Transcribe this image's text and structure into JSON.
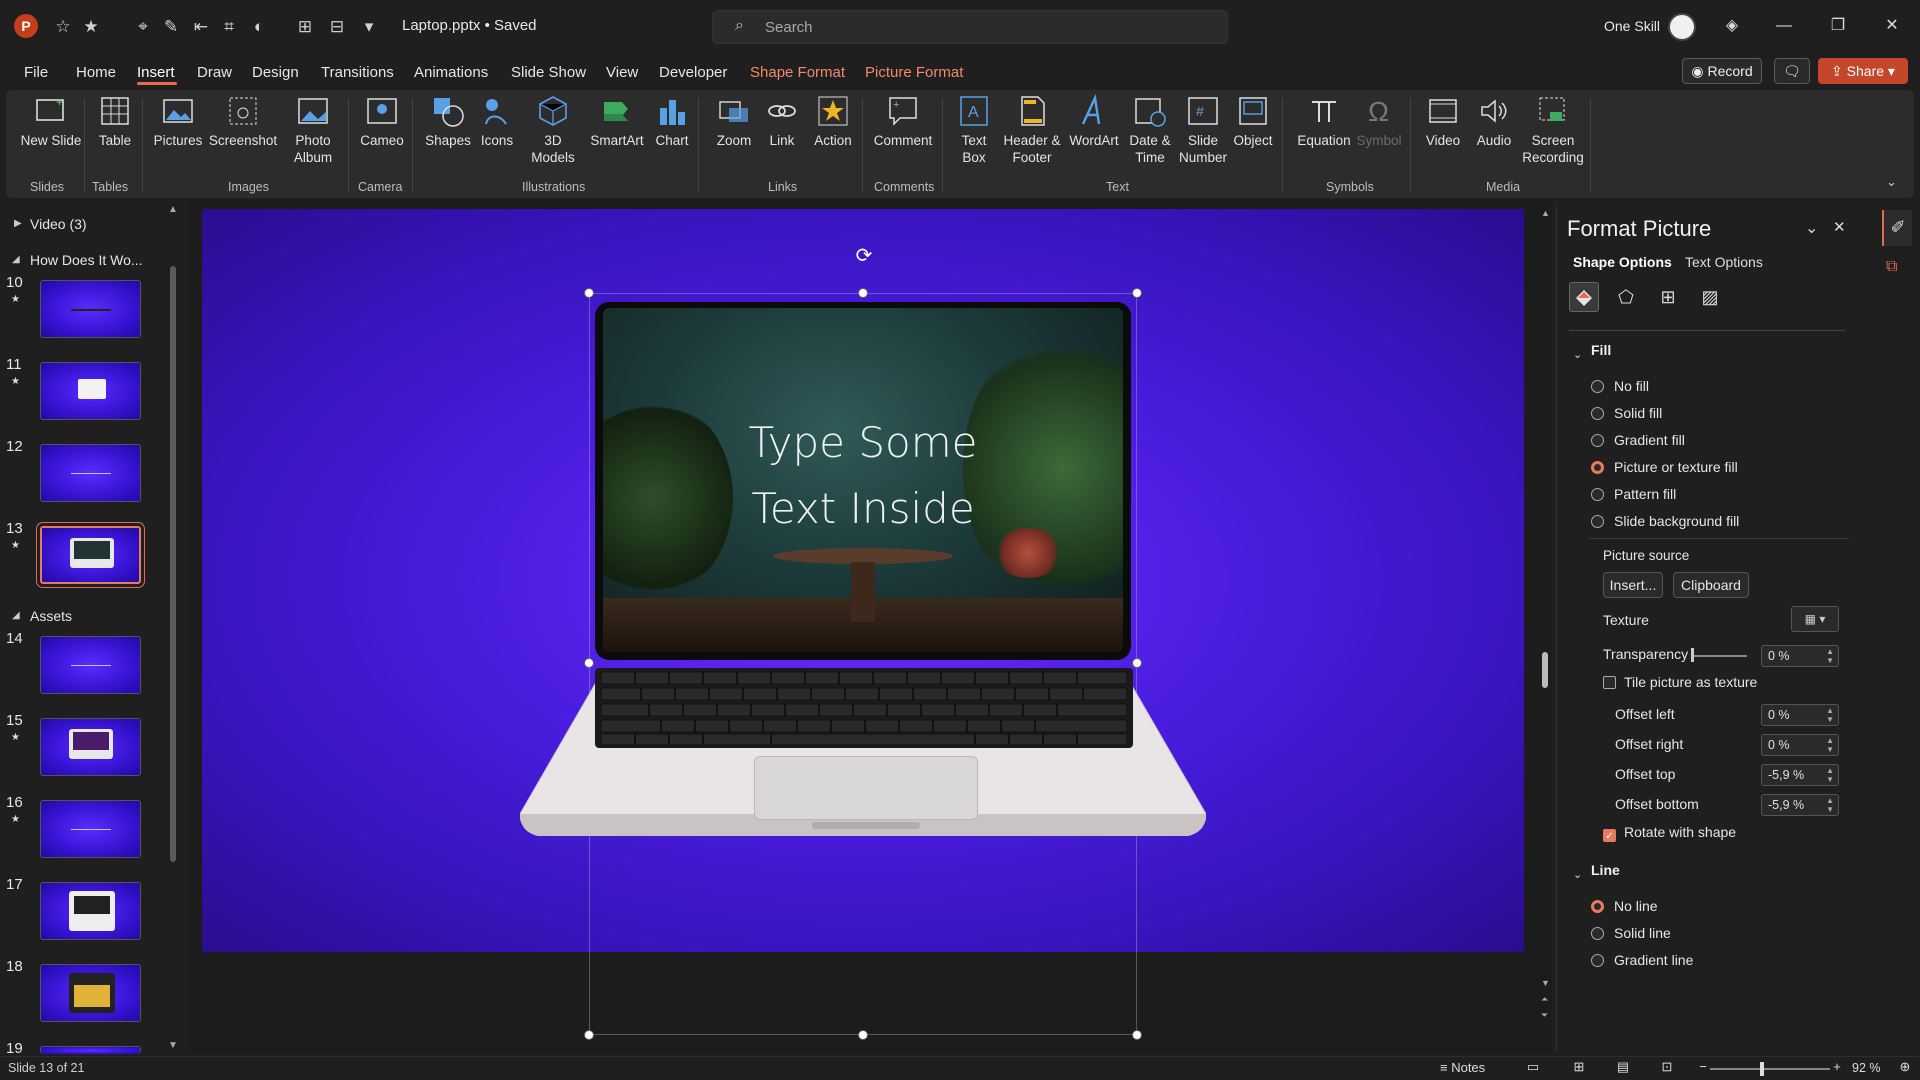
{
  "titlebar": {
    "doc_title": "Laptop.pptx • Saved",
    "search_placeholder": "Search",
    "user_name": "One Skill",
    "minimize": "—",
    "restore": "❐",
    "close": "✕"
  },
  "menu": {
    "tabs": [
      "File",
      "Home",
      "Insert",
      "Draw",
      "Design",
      "Transitions",
      "Animations",
      "Slide Show",
      "View",
      "Developer",
      "Shape Format",
      "Picture Format"
    ],
    "active": "Insert",
    "record": "Record",
    "share": "Share"
  },
  "ribbon": {
    "new_slide": "New Slide",
    "table": "Table",
    "pictures": "Pictures",
    "screenshot": "Screenshot",
    "photo_album": "Photo Album",
    "cameo": "Cameo",
    "shapes": "Shapes",
    "icons": "Icons",
    "models_3d": "3D Models",
    "smartart": "SmartArt",
    "chart": "Chart",
    "zoom": "Zoom",
    "link": "Link",
    "action": "Action",
    "comment": "Comment",
    "text_box": "Text Box",
    "header_footer": "Header & Footer",
    "wordart": "WordArt",
    "date_time": "Date & Time",
    "slide_number": "Slide Number",
    "object": "Object",
    "equation": "Equation",
    "symbol": "Symbol",
    "video": "Video",
    "audio": "Audio",
    "screen_recording": "Screen Recording",
    "groups": {
      "slides": "Slides",
      "tables": "Tables",
      "images": "Images",
      "camera": "Camera",
      "illustrations": "Illustrations",
      "links": "Links",
      "comments": "Comments",
      "text": "Text",
      "symbols": "Symbols",
      "media": "Media"
    }
  },
  "thumbnails": {
    "sections": [
      "Video (3)",
      "How Does It Wo...",
      "Assets"
    ],
    "numbers": [
      "10",
      "11",
      "12",
      "13",
      "14",
      "15",
      "16",
      "17",
      "18",
      "19"
    ],
    "selected": "13"
  },
  "slide": {
    "screen_line1": "Type Some",
    "screen_line2": "Text Inside"
  },
  "format_pane": {
    "title": "Format Picture",
    "tab_shape": "Shape Options",
    "tab_text": "Text Options",
    "fill_title": "Fill",
    "fill_options": [
      "No fill",
      "Solid fill",
      "Gradient fill",
      "Picture or texture fill",
      "Pattern fill",
      "Slide background fill"
    ],
    "fill_selected": "Picture or texture fill",
    "picture_source": "Picture source",
    "insert_btn": "Insert...",
    "clipboard_btn": "Clipboard",
    "texture": "Texture",
    "transparency": "Transparency",
    "transparency_val": "0 %",
    "tile_label": "Tile picture as texture",
    "offset_left": "Offset left",
    "offset_left_val": "0 %",
    "offset_right": "Offset right",
    "offset_right_val": "0 %",
    "offset_top": "Offset top",
    "offset_top_val": "-5,9 %",
    "offset_bottom": "Offset bottom",
    "offset_bottom_val": "-5,9 %",
    "rotate_label": "Rotate with shape",
    "line_title": "Line",
    "line_options": [
      "No line",
      "Solid line",
      "Gradient line"
    ],
    "line_selected": "No line"
  },
  "statusbar": {
    "slide_info": "Slide 13 of 21",
    "notes": "Notes",
    "zoom": "92 %"
  },
  "colors": {
    "accent": "#e87a5d",
    "slide_bg": "#4b1de0"
  }
}
